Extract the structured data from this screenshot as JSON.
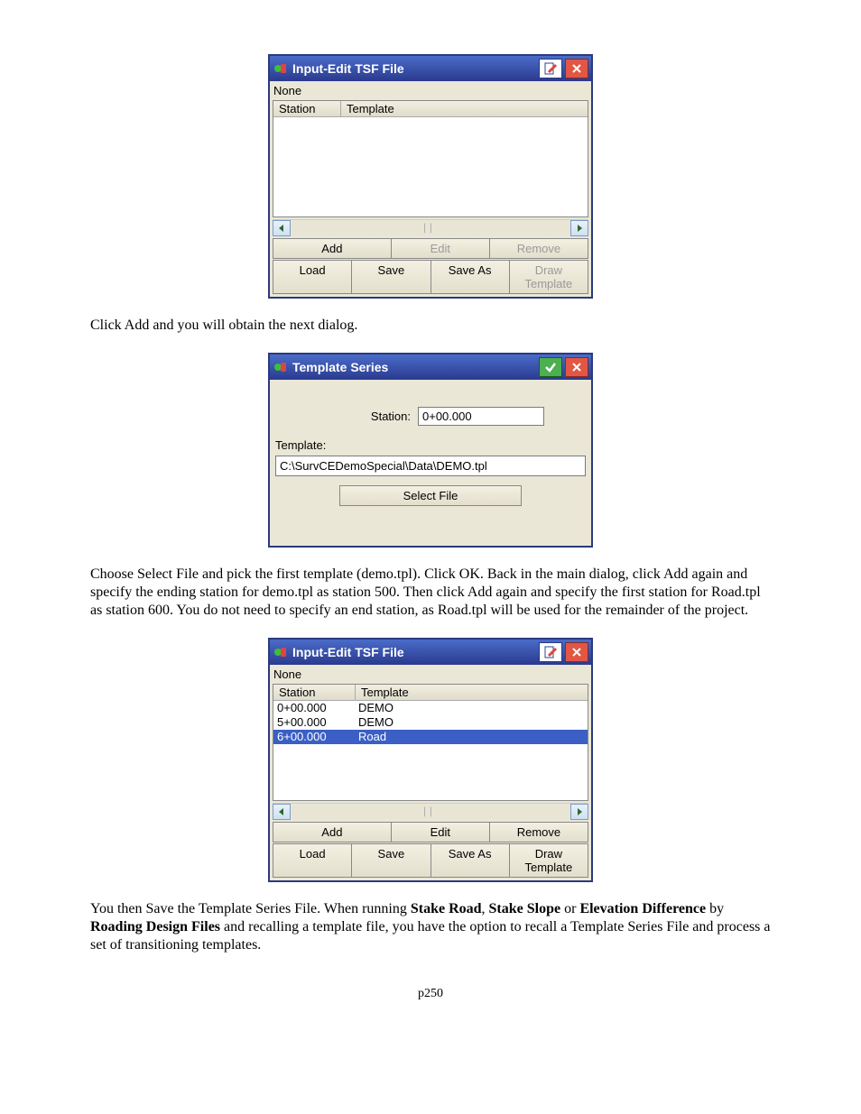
{
  "dlg1": {
    "title": "Input-Edit TSF File",
    "none": "None",
    "cols": {
      "station": "Station",
      "template": "Template"
    },
    "rows": [],
    "btns": {
      "add": "Add",
      "edit": "Edit",
      "remove": "Remove",
      "load": "Load",
      "save": "Save",
      "saveas": "Save As",
      "draw": "Draw Template"
    }
  },
  "para1": "Click Add and you will obtain the next dialog.",
  "dlg2": {
    "title": "Template Series",
    "station_label": "Station:",
    "station_value": "0+00.000",
    "template_label": "Template:",
    "path": "C:\\SurvCEDemoSpecial\\Data\\DEMO.tpl",
    "select": "Select File"
  },
  "para2": "Choose Select File and pick the first template (demo.tpl).  Click OK.  Back in the main dialog, click Add again and specify the ending station for demo.tpl as station 500.  Then click Add again and specify the first station for Road.tpl as station 600.  You do not need to specify an end station, as Road.tpl will be used for the remainder of the project.",
  "dlg3": {
    "title": "Input-Edit TSF File",
    "none": "None",
    "cols": {
      "station": "Station",
      "template": "Template"
    },
    "rows": [
      {
        "station": "0+00.000",
        "template": "DEMO",
        "selected": false
      },
      {
        "station": "5+00.000",
        "template": "DEMO",
        "selected": false
      },
      {
        "station": "6+00.000",
        "template": "Road",
        "selected": true
      }
    ],
    "btns": {
      "add": "Add",
      "edit": "Edit",
      "remove": "Remove",
      "load": "Load",
      "save": "Save",
      "saveas": "Save As",
      "draw": "Draw Template"
    }
  },
  "para3_parts": {
    "a": "You then Save the Template Series File. When running ",
    "b1": "Stake Road",
    "c": ", ",
    "b2": "Stake Slope",
    "d": " or ",
    "b3": "Elevation Difference",
    "e": " by ",
    "b4": "Roading Design Files",
    "f": " and recalling a template file, you have the option to recall a Template Series File and process a set of transitioning templates."
  },
  "page": "p250"
}
